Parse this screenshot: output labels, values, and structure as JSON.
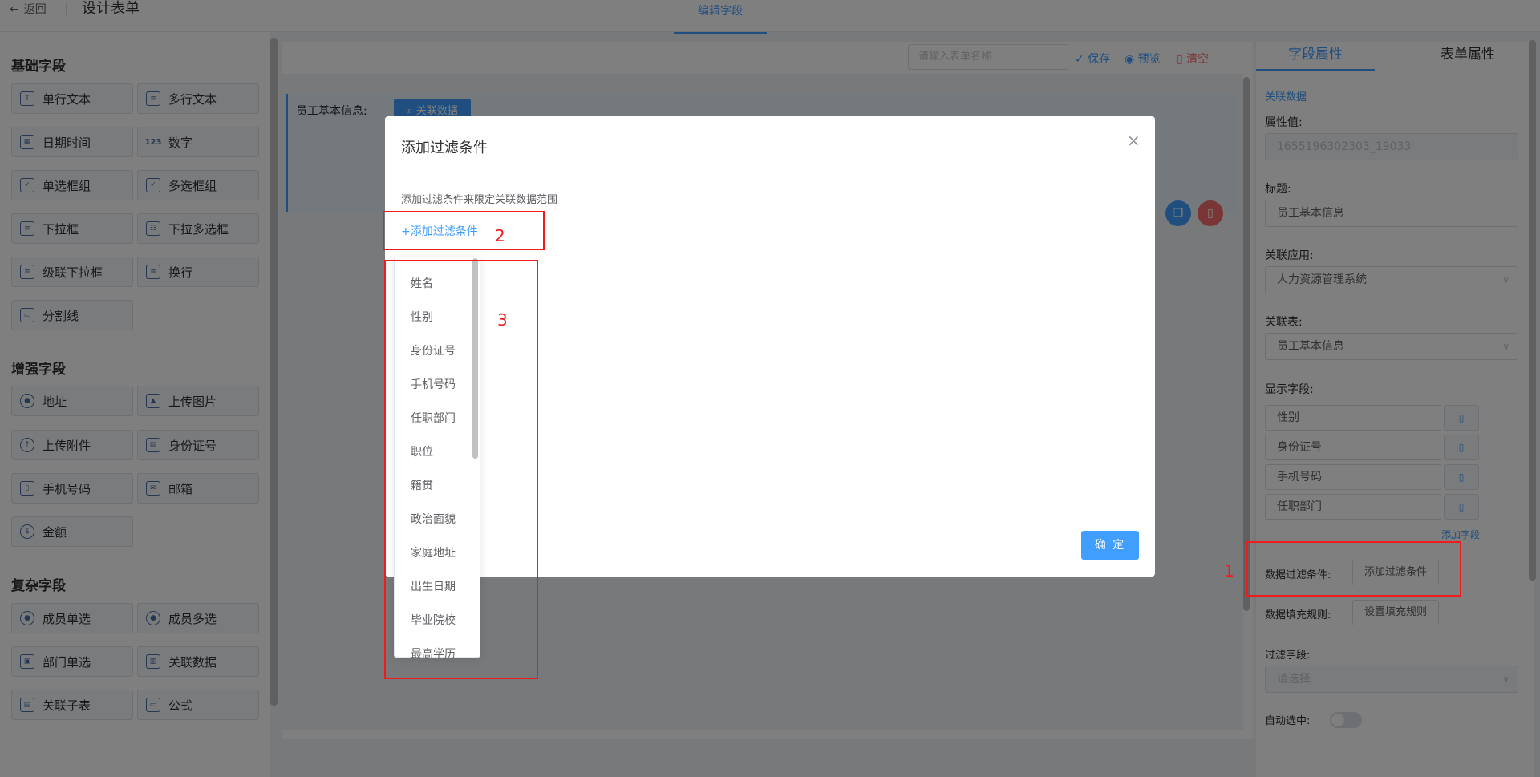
{
  "topbar": {
    "back_label": "返回",
    "title": "设计表单",
    "tab_label": "编辑字段"
  },
  "left": {
    "groups": {
      "basic": "基础字段",
      "enhanced": "增强字段",
      "complex": "复杂字段"
    },
    "basic_fields": [
      "单行文本",
      "多行文本",
      "日期时间",
      "数字",
      "单选框组",
      "多选框组",
      "下拉框",
      "下拉多选框",
      "级联下拉框",
      "换行",
      "分割线"
    ],
    "enhanced_fields": [
      "地址",
      "上传图片",
      "上传附件",
      "身份证号",
      "手机号码",
      "邮箱",
      "金额"
    ],
    "complex_fields": [
      "成员单选",
      "成员多选",
      "部门单选",
      "关联数据",
      "关联子表",
      "公式"
    ]
  },
  "toolbar": {
    "name_placeholder": "请输入表单名称",
    "save": "保存",
    "preview": "预览",
    "clear": "清空"
  },
  "canvas": {
    "field_label": "员工基本信息:",
    "rel_button": "关联数据"
  },
  "right": {
    "tab_field": "字段属性",
    "tab_form": "表单属性",
    "type_label": "关联数据",
    "attr_label": "属性值:",
    "attr_value": "1655196302303_19033",
    "title_label": "标题:",
    "title_value": "员工基本信息",
    "app_label": "关联应用:",
    "app_value": "人力资源管理系统",
    "table_label": "关联表:",
    "table_value": "员工基本信息",
    "display_label": "显示字段:",
    "display_fields": [
      "性别",
      "身份证号",
      "手机号码",
      "任职部门"
    ],
    "add_field": "添加字段",
    "filter_label": "数据过滤条件:",
    "filter_btn": "添加过滤条件",
    "fill_label": "数据填充规则:",
    "fill_btn": "设置填充规则",
    "filter_field_label": "过滤字段:",
    "filter_field_placeholder": "请选择",
    "auto_label": "自动选中:"
  },
  "dialog": {
    "title": "添加过滤条件",
    "desc": "添加过滤条件来限定关联数据范围",
    "add_link": "+添加过滤条件",
    "ok": "确 定",
    "options": [
      "姓名",
      "性别",
      "身份证号",
      "手机号码",
      "任职部门",
      "职位",
      "籍贯",
      "政治面貌",
      "家庭地址",
      "出生日期",
      "毕业院校",
      "最高学历"
    ]
  },
  "annotations": {
    "n1": "1",
    "n2": "2",
    "n3": "3"
  },
  "colors": {
    "accent": "#409eff",
    "danger": "#f56c6c",
    "annotation": "#ee1c1c"
  }
}
